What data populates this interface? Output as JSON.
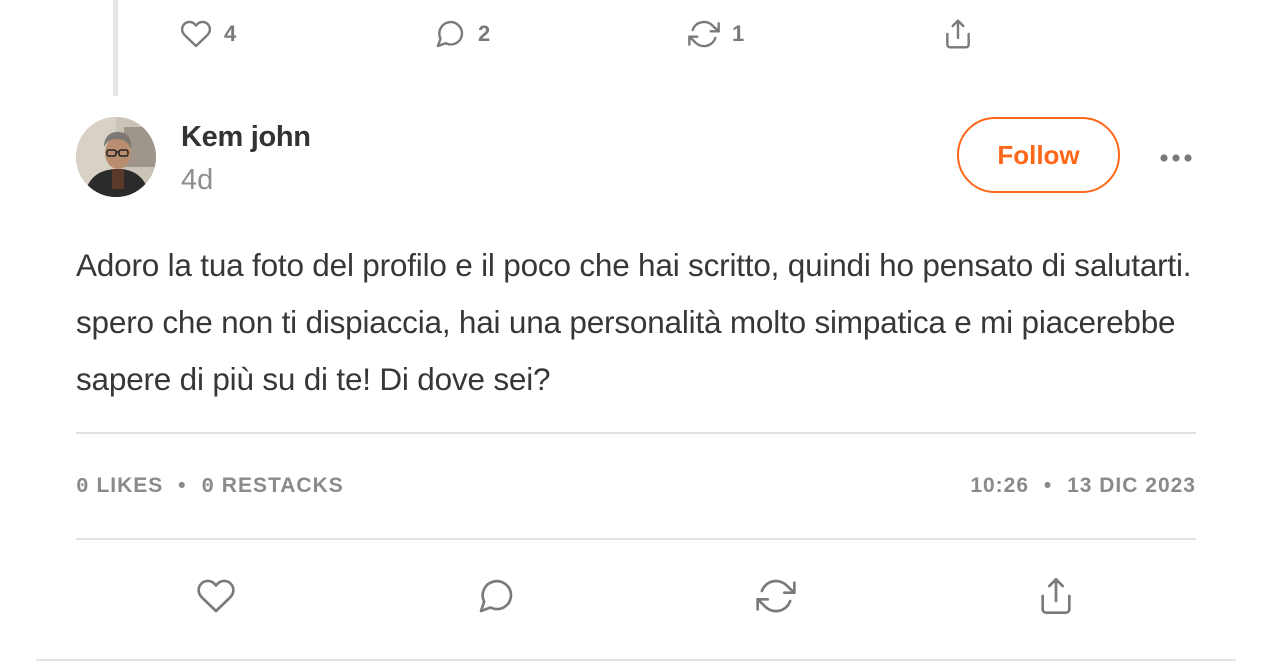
{
  "top_actions": {
    "like_count": "4",
    "comment_count": "2",
    "restack_count": "1"
  },
  "comment": {
    "author_name": "Kem john",
    "age": "4d",
    "follow_label": "Follow",
    "body": "Adoro la tua foto del profilo e il poco che hai scritto, quindi ho pensato di salutarti. spero che non ti dispiaccia, hai una personalità molto simpatica e mi piacerebbe sapere di più su di te! Di dove sei?"
  },
  "stats": {
    "likes_count": "0",
    "likes_label": "LIKES",
    "separator": "•",
    "restacks_count": "0",
    "restacks_label": "RESTACKS",
    "time": "10:26",
    "date": "13 DIC 2023"
  },
  "icons": {
    "like": "heart-icon",
    "comment": "comment-bubble-icon",
    "restack": "restack-arrows-icon",
    "share": "share-upload-icon",
    "more": "more-dots-icon"
  },
  "colors": {
    "accent": "#ff6719",
    "muted_text": "#8a8a8a",
    "body_text": "#363737"
  }
}
